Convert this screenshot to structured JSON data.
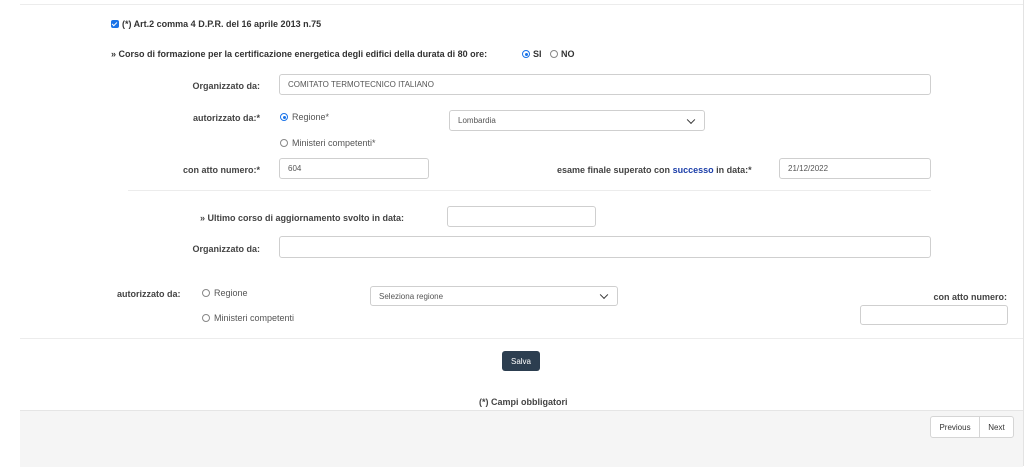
{
  "art_checkbox_label": "(*) Art.2 comma 4 D.P.R. del 16 aprile 2013 n.75",
  "corso": {
    "question": "» Corso di formazione per la certificazione energetica degli edifici della durata di 80 ore:",
    "si_label": "SI",
    "no_label": "NO",
    "selected": "SI"
  },
  "section1": {
    "organizzato_label": "Organizzato da:",
    "organizzato_value": "COMITATO TERMOTECNICO ITALIANO",
    "autorizzato_label": "autorizzato da:*",
    "regione_label": "Regione*",
    "regione_selected": "Lombardia",
    "ministeri_label": "Ministeri competenti*",
    "atto_label": "con atto numero:*",
    "atto_value": "604",
    "esame_label_pre": "esame finale superato con",
    "esame_label_link": "successo",
    "esame_label_post": "in data:*",
    "esame_value": "21/12/2022"
  },
  "section2": {
    "ultimo_label": "» Ultimo corso di aggiornamento svolto in data:",
    "ultimo_value": "",
    "organizzato_label": "Organizzato da:",
    "organizzato_value": "",
    "autorizzato_label": "autorizzato da:",
    "regione_label": "Regione",
    "regione_placeholder": "Seleziona regione",
    "ministeri_label": "Ministeri competenti",
    "atto_label": "con atto numero:",
    "atto_value": ""
  },
  "save_label": "Salva",
  "mandatory_note": "(*) Campi obbligatori",
  "pager": {
    "previous": "Previous",
    "next": "Next"
  },
  "colors": {
    "accent": "#1a73e8",
    "button": "#2c3e50",
    "link": "#1a3da8"
  }
}
